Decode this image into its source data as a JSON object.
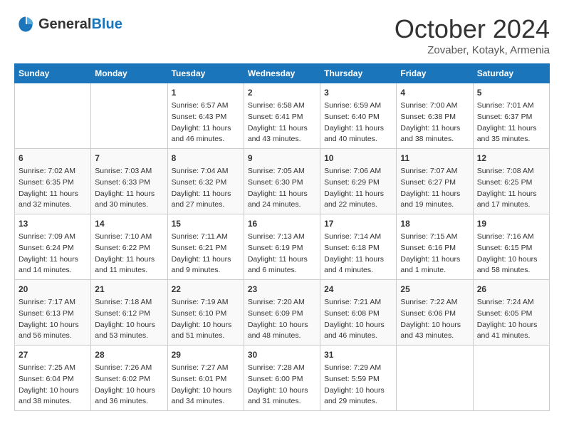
{
  "header": {
    "logo_general": "General",
    "logo_blue": "Blue",
    "title": "October 2024",
    "subtitle": "Zovaber, Kotayk, Armenia"
  },
  "days_of_week": [
    "Sunday",
    "Monday",
    "Tuesday",
    "Wednesday",
    "Thursday",
    "Friday",
    "Saturday"
  ],
  "weeks": [
    [
      {
        "day": "",
        "data": ""
      },
      {
        "day": "",
        "data": ""
      },
      {
        "day": "1",
        "data": "Sunrise: 6:57 AM\nSunset: 6:43 PM\nDaylight: 11 hours and 46 minutes."
      },
      {
        "day": "2",
        "data": "Sunrise: 6:58 AM\nSunset: 6:41 PM\nDaylight: 11 hours and 43 minutes."
      },
      {
        "day": "3",
        "data": "Sunrise: 6:59 AM\nSunset: 6:40 PM\nDaylight: 11 hours and 40 minutes."
      },
      {
        "day": "4",
        "data": "Sunrise: 7:00 AM\nSunset: 6:38 PM\nDaylight: 11 hours and 38 minutes."
      },
      {
        "day": "5",
        "data": "Sunrise: 7:01 AM\nSunset: 6:37 PM\nDaylight: 11 hours and 35 minutes."
      }
    ],
    [
      {
        "day": "6",
        "data": "Sunrise: 7:02 AM\nSunset: 6:35 PM\nDaylight: 11 hours and 32 minutes."
      },
      {
        "day": "7",
        "data": "Sunrise: 7:03 AM\nSunset: 6:33 PM\nDaylight: 11 hours and 30 minutes."
      },
      {
        "day": "8",
        "data": "Sunrise: 7:04 AM\nSunset: 6:32 PM\nDaylight: 11 hours and 27 minutes."
      },
      {
        "day": "9",
        "data": "Sunrise: 7:05 AM\nSunset: 6:30 PM\nDaylight: 11 hours and 24 minutes."
      },
      {
        "day": "10",
        "data": "Sunrise: 7:06 AM\nSunset: 6:29 PM\nDaylight: 11 hours and 22 minutes."
      },
      {
        "day": "11",
        "data": "Sunrise: 7:07 AM\nSunset: 6:27 PM\nDaylight: 11 hours and 19 minutes."
      },
      {
        "day": "12",
        "data": "Sunrise: 7:08 AM\nSunset: 6:25 PM\nDaylight: 11 hours and 17 minutes."
      }
    ],
    [
      {
        "day": "13",
        "data": "Sunrise: 7:09 AM\nSunset: 6:24 PM\nDaylight: 11 hours and 14 minutes."
      },
      {
        "day": "14",
        "data": "Sunrise: 7:10 AM\nSunset: 6:22 PM\nDaylight: 11 hours and 11 minutes."
      },
      {
        "day": "15",
        "data": "Sunrise: 7:11 AM\nSunset: 6:21 PM\nDaylight: 11 hours and 9 minutes."
      },
      {
        "day": "16",
        "data": "Sunrise: 7:13 AM\nSunset: 6:19 PM\nDaylight: 11 hours and 6 minutes."
      },
      {
        "day": "17",
        "data": "Sunrise: 7:14 AM\nSunset: 6:18 PM\nDaylight: 11 hours and 4 minutes."
      },
      {
        "day": "18",
        "data": "Sunrise: 7:15 AM\nSunset: 6:16 PM\nDaylight: 11 hours and 1 minute."
      },
      {
        "day": "19",
        "data": "Sunrise: 7:16 AM\nSunset: 6:15 PM\nDaylight: 10 hours and 58 minutes."
      }
    ],
    [
      {
        "day": "20",
        "data": "Sunrise: 7:17 AM\nSunset: 6:13 PM\nDaylight: 10 hours and 56 minutes."
      },
      {
        "day": "21",
        "data": "Sunrise: 7:18 AM\nSunset: 6:12 PM\nDaylight: 10 hours and 53 minutes."
      },
      {
        "day": "22",
        "data": "Sunrise: 7:19 AM\nSunset: 6:10 PM\nDaylight: 10 hours and 51 minutes."
      },
      {
        "day": "23",
        "data": "Sunrise: 7:20 AM\nSunset: 6:09 PM\nDaylight: 10 hours and 48 minutes."
      },
      {
        "day": "24",
        "data": "Sunrise: 7:21 AM\nSunset: 6:08 PM\nDaylight: 10 hours and 46 minutes."
      },
      {
        "day": "25",
        "data": "Sunrise: 7:22 AM\nSunset: 6:06 PM\nDaylight: 10 hours and 43 minutes."
      },
      {
        "day": "26",
        "data": "Sunrise: 7:24 AM\nSunset: 6:05 PM\nDaylight: 10 hours and 41 minutes."
      }
    ],
    [
      {
        "day": "27",
        "data": "Sunrise: 7:25 AM\nSunset: 6:04 PM\nDaylight: 10 hours and 38 minutes."
      },
      {
        "day": "28",
        "data": "Sunrise: 7:26 AM\nSunset: 6:02 PM\nDaylight: 10 hours and 36 minutes."
      },
      {
        "day": "29",
        "data": "Sunrise: 7:27 AM\nSunset: 6:01 PM\nDaylight: 10 hours and 34 minutes."
      },
      {
        "day": "30",
        "data": "Sunrise: 7:28 AM\nSunset: 6:00 PM\nDaylight: 10 hours and 31 minutes."
      },
      {
        "day": "31",
        "data": "Sunrise: 7:29 AM\nSunset: 5:59 PM\nDaylight: 10 hours and 29 minutes."
      },
      {
        "day": "",
        "data": ""
      },
      {
        "day": "",
        "data": ""
      }
    ]
  ]
}
